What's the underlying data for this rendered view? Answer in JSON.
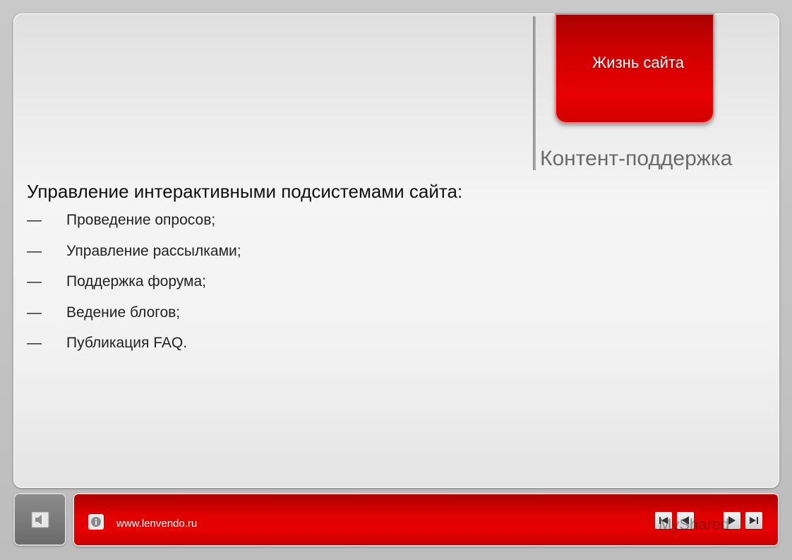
{
  "header": {
    "section_tab_label": "Жизнь сайта",
    "page_title": "Контент-поддержка"
  },
  "main": {
    "heading": "Управление интерактивными подсистемами сайта:",
    "bullet_marker": "—",
    "items": [
      "Проведение опросов;",
      "Управление рассылками;",
      "Поддержка форума;",
      "Ведение блогов;",
      "Публикация FAQ."
    ]
  },
  "footer": {
    "site_url": "www.lenvendo.ru",
    "watermark": "MyShared",
    "icons": {
      "sound": "speaker-icon",
      "info": "info-icon",
      "first": "skip-back-icon",
      "prev": "prev-icon",
      "next": "next-icon",
      "last": "skip-forward-icon"
    }
  },
  "colors": {
    "accent_red": "#e00000",
    "title_gray": "#6a6a6a"
  }
}
